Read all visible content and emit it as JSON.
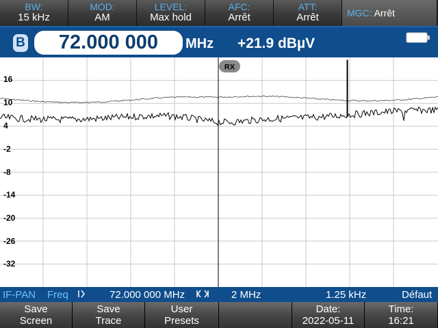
{
  "top_params": [
    {
      "label": "BW:",
      "value": "15 kHz"
    },
    {
      "label": "MOD:",
      "value": "AM"
    },
    {
      "label": "LEVEL:",
      "value": "Max hold"
    },
    {
      "label": "AFC:",
      "value": "Arrêt"
    },
    {
      "label": "ATT:",
      "value": "Arrêt"
    },
    {
      "label": "MGC:",
      "value": "Arrêt"
    }
  ],
  "freq": {
    "badge": "B",
    "value": "72.000 000",
    "unit": "MHz",
    "level": "+21.9 dBµV"
  },
  "display": {
    "rx_label": "RX",
    "y_ticks": [
      "16",
      "10",
      "4",
      "-2",
      "-8",
      "-14",
      "-20",
      "-26",
      "-32"
    ]
  },
  "status": {
    "mode": "IF-PAN",
    "freq_label": "Freq",
    "center_icon": "center-marker-icon",
    "center": "72.000 000 MHz",
    "span_icon": "span-marker-icon",
    "span": "2 MHz",
    "resolution": "1.25 kHz",
    "preset": "Défaut"
  },
  "softkeys": [
    {
      "line1": "Save",
      "line2": "Screen"
    },
    {
      "line1": "Save",
      "line2": "Trace"
    },
    {
      "line1": "User",
      "line2": "Presets"
    },
    {
      "line1": "",
      "line2": ""
    },
    {
      "line1": "Date:",
      "line2": "2022-05-11"
    },
    {
      "line1": "Time:",
      "line2": "16:21"
    }
  ],
  "colors": {
    "accent_blue": "#0f4d8c",
    "label_blue": "#5ab0e8",
    "grid": "#c8c8c8",
    "trace": "#000000"
  }
}
